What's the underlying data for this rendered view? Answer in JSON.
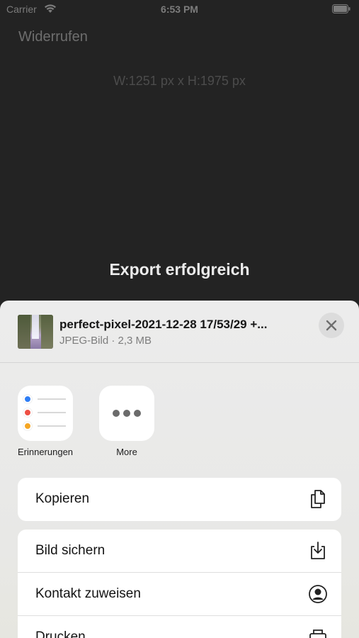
{
  "status_bar": {
    "carrier": "Carrier",
    "time": "6:53 PM"
  },
  "background": {
    "undo_label": "Widerrufen",
    "dimensions": "W:1251 px x H:1975 px",
    "export_message": "Export erfolgreich"
  },
  "share_sheet": {
    "file_name": "perfect-pixel-2021-12-28 17/53/29 +...",
    "file_meta": "JPEG-Bild · 2,3 MB",
    "apps": [
      {
        "label": "Erinnerungen",
        "icon": "reminders-app-icon"
      },
      {
        "label": "More",
        "icon": "more-dots-icon"
      }
    ],
    "actions": [
      {
        "label": "Kopieren",
        "icon": "copy-icon"
      },
      {
        "label": "Bild sichern",
        "icon": "save-image-icon"
      },
      {
        "label": "Kontakt zuweisen",
        "icon": "contact-icon"
      },
      {
        "label": "Drucken",
        "icon": "printer-icon"
      }
    ]
  },
  "colors": {
    "reminder_blue": "#2f7ef5",
    "reminder_red": "#ee4f43",
    "reminder_orange": "#f5a623"
  }
}
